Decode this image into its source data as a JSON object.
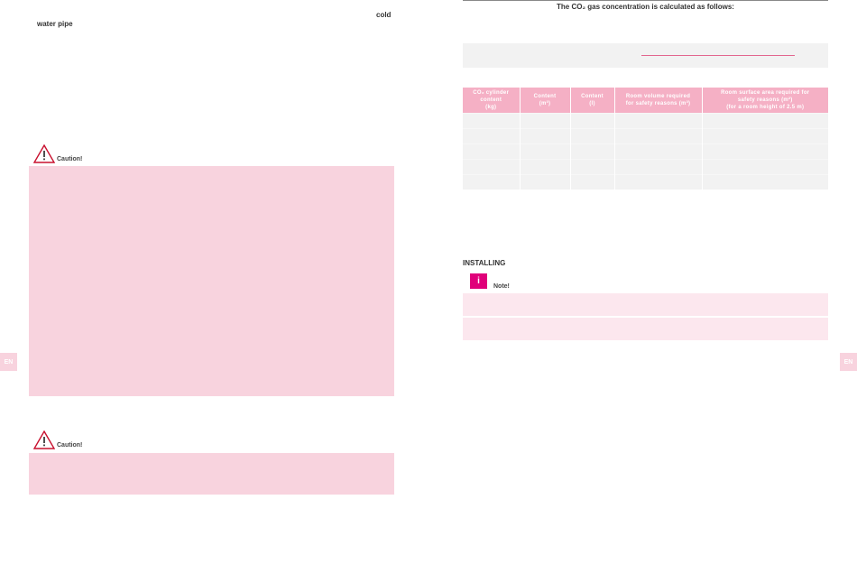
{
  "left_page": {
    "text_cold": "cold",
    "text_water_pipe": "water pipe",
    "caution_1_label": "Caution!",
    "caution_2_label": "Caution!",
    "tab_label": "EN"
  },
  "right_page": {
    "heading": "The CO₂ gas concentration is calculated as follows:",
    "table": {
      "headers": [
        [
          "CO₂ cylinder",
          "content",
          "(kg)"
        ],
        [
          "Content",
          "(m³)"
        ],
        [
          "Content",
          "(l)"
        ],
        [
          "Room volume required",
          "for safety reasons (m³)"
        ],
        [
          "Room surface area required for",
          "safety reasons (m²)",
          "(for a room height of 2.5 m)"
        ]
      ]
    },
    "installing_heading": "INSTALLING",
    "note_icon": "i",
    "note_label": "Note!",
    "tab_label": "EN"
  },
  "colors": {
    "pink_block": "#f8d3de",
    "table_header": "#f5b0c5",
    "accent_magenta": "#e0007a",
    "warning_red": "#c8102e"
  },
  "icons": [
    "warning-triangle-icon",
    "info-icon"
  ]
}
